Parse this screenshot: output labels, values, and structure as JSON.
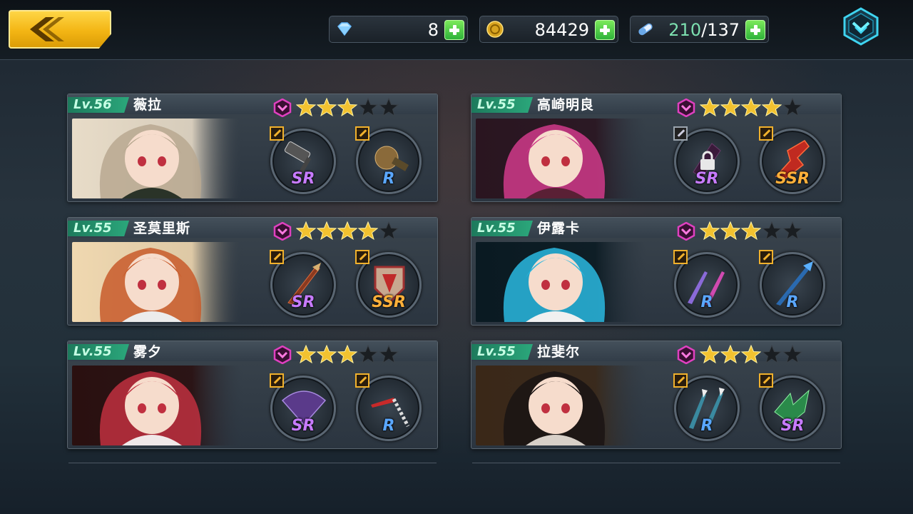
{
  "resources": {
    "diamonds": {
      "value": "8",
      "icon": "diamond-icon"
    },
    "gold": {
      "value": "84429",
      "icon": "gold-coin-icon"
    },
    "stamina": {
      "current": "210",
      "max": "/137",
      "icon": "stamina-capsule-icon"
    }
  },
  "colors": {
    "accent": "#f3b514",
    "level_green": "#2ba77b",
    "star": "#f2c230",
    "rank_pink": "#e040c0"
  },
  "cards": [
    {
      "level": "Lv.56",
      "name": "薇拉",
      "stars_filled": 3,
      "stars_total": 5,
      "weapons": [
        {
          "rarity": "SR",
          "icon": "hammer-weapon-icon",
          "locked": false
        },
        {
          "rarity": "R",
          "icon": "gauntlet-weapon-icon",
          "locked": false
        }
      ]
    },
    {
      "level": "Lv.55",
      "name": "高崎明良",
      "stars_filled": 4,
      "stars_total": 5,
      "weapons": [
        {
          "rarity": "SR",
          "icon": "locked-weapon-icon",
          "locked": true
        },
        {
          "rarity": "SSR",
          "icon": "guitar-weapon-icon",
          "locked": false
        }
      ]
    },
    {
      "level": "Lv.55",
      "name": "圣莫里斯",
      "stars_filled": 4,
      "stars_total": 5,
      "weapons": [
        {
          "rarity": "SR",
          "icon": "lance-weapon-icon",
          "locked": false
        },
        {
          "rarity": "SSR",
          "icon": "shield-weapon-icon",
          "locked": false
        }
      ]
    },
    {
      "level": "Lv.55",
      "name": "伊露卡",
      "stars_filled": 3,
      "stars_total": 5,
      "weapons": [
        {
          "rarity": "R",
          "icon": "twin-blades-weapon-icon",
          "locked": false
        },
        {
          "rarity": "R",
          "icon": "spear-weapon-icon",
          "locked": false
        }
      ]
    },
    {
      "level": "Lv.55",
      "name": "雾夕",
      "stars_filled": 3,
      "stars_total": 5,
      "weapons": [
        {
          "rarity": "SR",
          "icon": "fan-weapon-icon",
          "locked": false
        },
        {
          "rarity": "R",
          "icon": "chain-blade-weapon-icon",
          "locked": false
        }
      ]
    },
    {
      "level": "Lv.55",
      "name": "拉斐尔",
      "stars_filled": 3,
      "stars_total": 5,
      "weapons": [
        {
          "rarity": "R",
          "icon": "twin-spears-weapon-icon",
          "locked": false
        },
        {
          "rarity": "SR",
          "icon": "claw-weapon-icon",
          "locked": false
        }
      ]
    }
  ]
}
